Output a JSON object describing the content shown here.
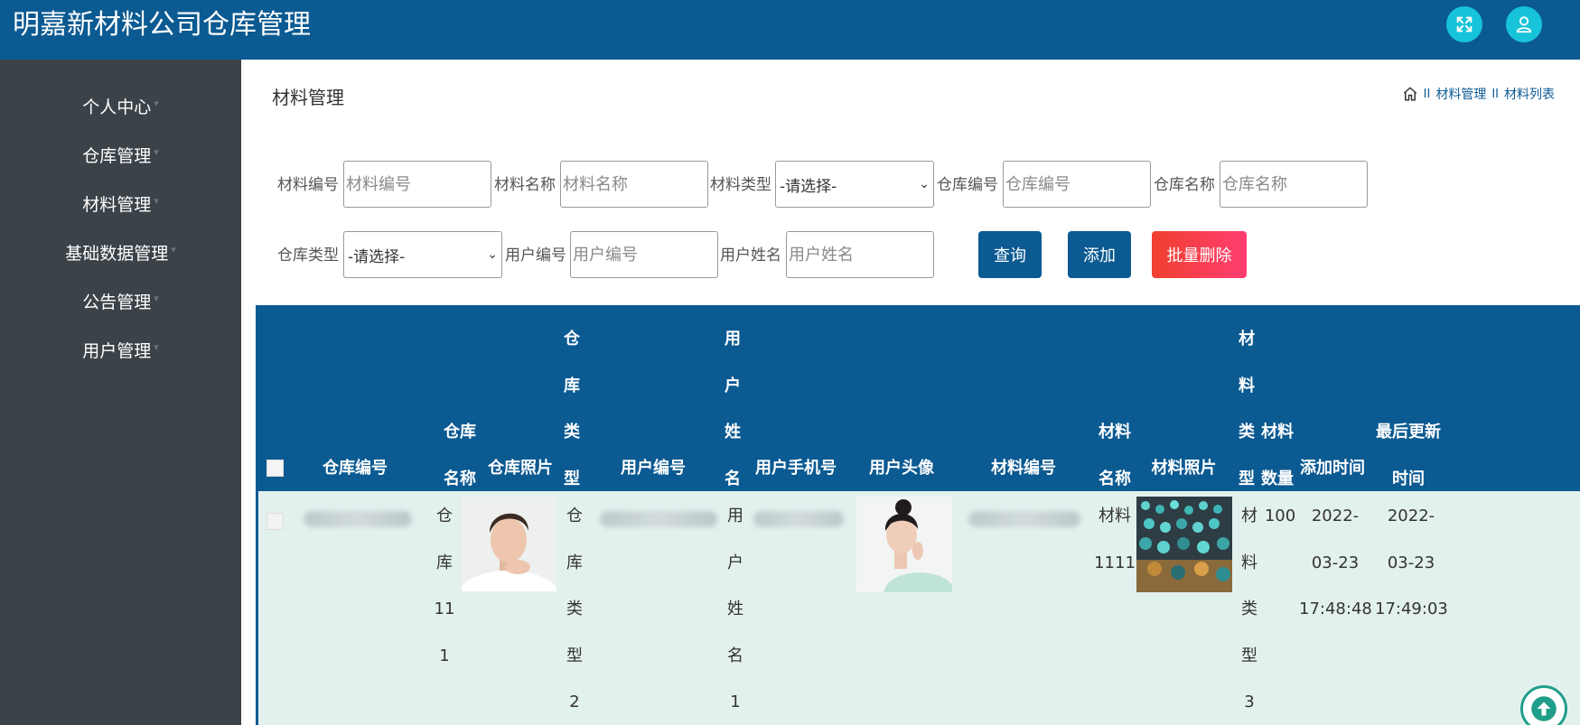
{
  "app": {
    "title": "明嘉新材料公司仓库管理"
  },
  "header": {
    "icons": [
      "fullscreen-icon",
      "user-icon"
    ]
  },
  "sidebar": {
    "items": [
      {
        "label": "个人中心"
      },
      {
        "label": "仓库管理"
      },
      {
        "label": "材料管理"
      },
      {
        "label": "基础数据管理"
      },
      {
        "label": "公告管理"
      },
      {
        "label": "用户管理"
      }
    ]
  },
  "page": {
    "title": "材料管理",
    "breadcrumb": {
      "sep": "II",
      "items": [
        "材料管理",
        "材料列表"
      ]
    }
  },
  "filters": {
    "material_code": {
      "label": "材料编号",
      "placeholder": "材料编号"
    },
    "material_name": {
      "label": "材料名称",
      "placeholder": "材料名称"
    },
    "material_type": {
      "label": "材料类型",
      "value": "-请选择-"
    },
    "warehouse_code": {
      "label": "仓库编号",
      "placeholder": "仓库编号"
    },
    "warehouse_name": {
      "label": "仓库名称",
      "placeholder": "仓库名称"
    },
    "warehouse_type": {
      "label": "仓库类型",
      "value": "-请选择-"
    },
    "user_code": {
      "label": "用户编号",
      "placeholder": "用户编号"
    },
    "user_name": {
      "label": "用户姓名",
      "placeholder": "用户姓名"
    }
  },
  "buttons": {
    "query": "查询",
    "add": "添加",
    "batch_delete": "批量删除"
  },
  "table": {
    "headers": {
      "warehouse_code": "仓库编号",
      "warehouse_name": "仓库名称",
      "warehouse_photo": "仓库照片",
      "warehouse_type": "仓库类型",
      "user_code": "用户编号",
      "user_name": "用户姓名",
      "user_phone": "用户手机号",
      "user_avatar": "用户头像",
      "material_code": "材料编号",
      "material_name": "材料名称",
      "material_photo": "材料照片",
      "material_type": "材料类型",
      "material_qty": "材料数量",
      "added_time": "添加时间",
      "updated_time": "最后更新时间"
    },
    "rows": [
      {
        "warehouse_name": "仓库111",
        "warehouse_type": "仓库类型2",
        "user_name": "用户姓名1",
        "material_name": "材料1111",
        "material_type": "材料类型3",
        "material_qty": "100",
        "added_date": "2022-03-23",
        "added_clock": "17:48:48",
        "updated_date": "2022-03-23",
        "updated_clock": "17:49:03"
      }
    ]
  },
  "colors": {
    "primary": "#0b5a92",
    "sidebar": "#3b4349",
    "accent": "#17c3d9",
    "danger": "#f0402f",
    "row_bg": "#e3f1ee"
  }
}
